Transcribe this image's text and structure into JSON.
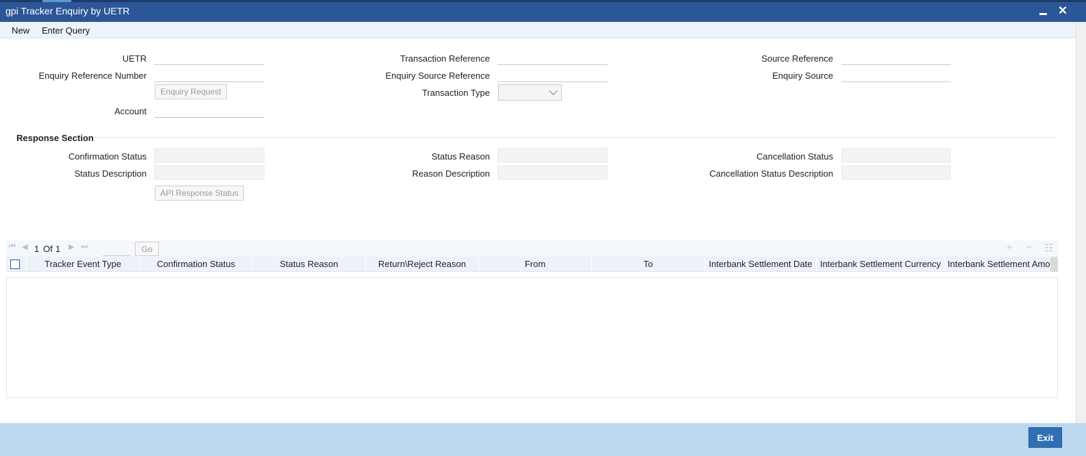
{
  "window": {
    "title": "gpi Tracker Enquiry by UETR",
    "close_glyph": "✕"
  },
  "menu": {
    "new": "New",
    "enter_query": "Enter Query"
  },
  "form": {
    "uetr": {
      "label": "UETR",
      "value": ""
    },
    "transaction_reference": {
      "label": "Transaction Reference",
      "value": ""
    },
    "source_reference": {
      "label": "Source Reference",
      "value": ""
    },
    "enquiry_reference_number": {
      "label": "Enquiry Reference Number",
      "value": ""
    },
    "enquiry_source_reference": {
      "label": "Enquiry Source Reference",
      "value": ""
    },
    "enquiry_source": {
      "label": "Enquiry Source",
      "value": ""
    },
    "enquiry_request_button": "Enquiry Request",
    "transaction_type": {
      "label": "Transaction Type",
      "selected": ""
    },
    "account": {
      "label": "Account",
      "value": ""
    }
  },
  "response": {
    "section_title": "Response Section",
    "confirmation_status": {
      "label": "Confirmation Status",
      "value": ""
    },
    "status_reason": {
      "label": "Status Reason",
      "value": ""
    },
    "cancellation_status": {
      "label": "Cancellation Status",
      "value": ""
    },
    "status_description": {
      "label": "Status Description",
      "value": ""
    },
    "reason_description": {
      "label": "Reason Description",
      "value": ""
    },
    "cancellation_status_description": {
      "label": "Cancellation Status Description",
      "value": ""
    },
    "api_response_button": "API Response Status"
  },
  "grid": {
    "pager": {
      "current": "1",
      "of_label": "Of",
      "total": "1",
      "go_label": "Go"
    },
    "icons": {
      "first": "⏮",
      "prev": "◀",
      "next": "▶",
      "last": "⏭",
      "add": "+",
      "remove": "−",
      "columns": "☷"
    },
    "columns": [
      "Tracker Event Type",
      "Confirmation Status",
      "Status Reason",
      "Return\\Reject Reason",
      "From",
      "To",
      "Interbank Settlement Date",
      "Interbank Settlement Currency",
      "Interbank Settlement Amou"
    ],
    "rows": []
  },
  "footer": {
    "exit": "Exit"
  },
  "colors": {
    "titlebar": "#2b5797",
    "footer": "#bcd7ee",
    "exit_button": "#2f6fb3"
  }
}
